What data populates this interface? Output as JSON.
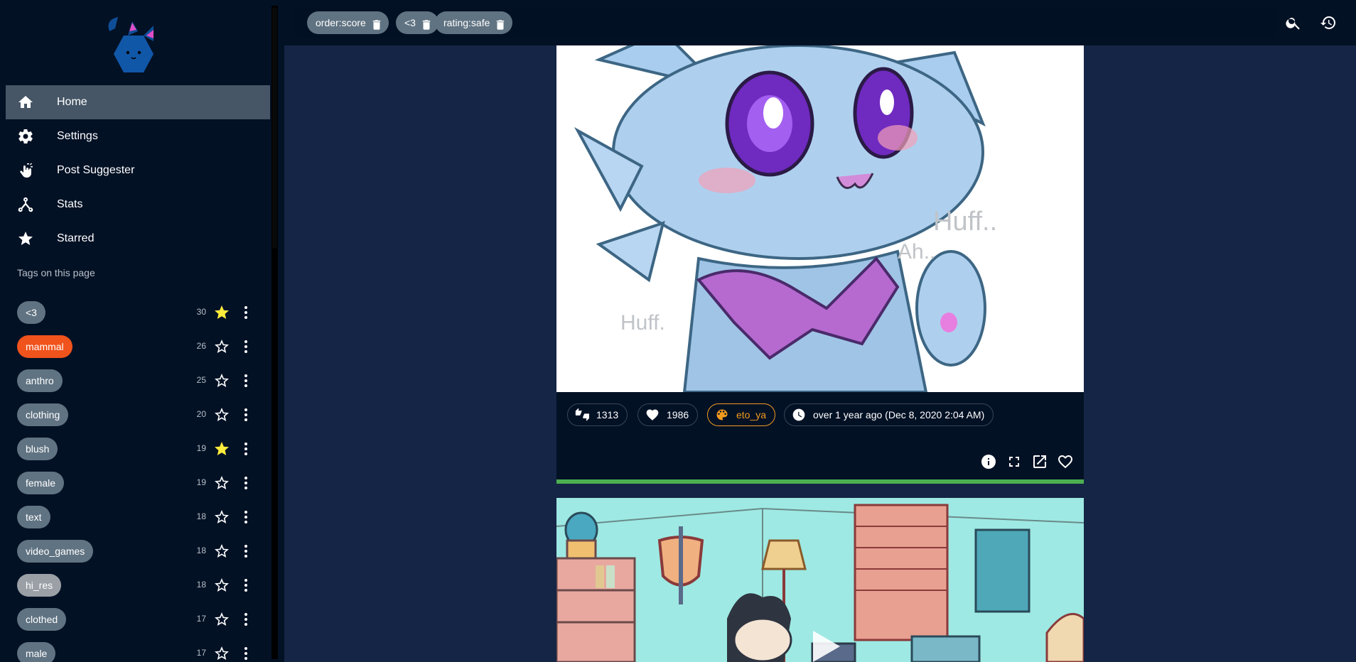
{
  "sidebar": {
    "nav": [
      {
        "label": "Home",
        "icon": "home-icon",
        "active": true
      },
      {
        "label": "Settings",
        "icon": "gear-icon",
        "active": false
      },
      {
        "label": "Post Suggester",
        "icon": "swipe-hand-icon",
        "active": false
      },
      {
        "label": "Stats",
        "icon": "graph-icon",
        "active": false
      },
      {
        "label": "Starred",
        "icon": "star-icon",
        "active": false
      }
    ],
    "tags_heading": "Tags on this page",
    "tags": [
      {
        "name": "<3",
        "count": "30",
        "starred": true,
        "color": "#607382"
      },
      {
        "name": "mammal",
        "count": "26",
        "starred": false,
        "color": "#f0531c"
      },
      {
        "name": "anthro",
        "count": "25",
        "starred": false,
        "color": "#607382"
      },
      {
        "name": "clothing",
        "count": "20",
        "starred": false,
        "color": "#607382"
      },
      {
        "name": "blush",
        "count": "19",
        "starred": true,
        "color": "#607382"
      },
      {
        "name": "female",
        "count": "19",
        "starred": false,
        "color": "#607382"
      },
      {
        "name": "text",
        "count": "18",
        "starred": false,
        "color": "#607382"
      },
      {
        "name": "video_games",
        "count": "18",
        "starred": false,
        "color": "#607382"
      },
      {
        "name": "hi_res",
        "count": "18",
        "starred": false,
        "color": "#9aa0a6"
      },
      {
        "name": "clothed",
        "count": "17",
        "starred": false,
        "color": "#607382"
      },
      {
        "name": "male",
        "count": "17",
        "starred": false,
        "color": "#607382"
      }
    ]
  },
  "topbar": {
    "query_tags": [
      "order:score",
      "<3",
      "rating:safe"
    ],
    "search_icon": "search-icon",
    "history_icon": "history-icon"
  },
  "post1": {
    "score": "1313",
    "favorites": "1986",
    "artist": "eto_ya",
    "date": "over 1 year ago (Dec 8, 2020 2:04 AM)",
    "actions": [
      "info-icon",
      "fullscreen-icon",
      "open-external-icon",
      "heart-outline-icon"
    ],
    "progress": 1.0,
    "progress_color": "#4caf50"
  },
  "colors": {
    "background": "#152545",
    "sidebar": "#031125",
    "chip": "#607382",
    "accent_orange": "#f29a1f",
    "star_yellow": "#ffeb3b"
  }
}
